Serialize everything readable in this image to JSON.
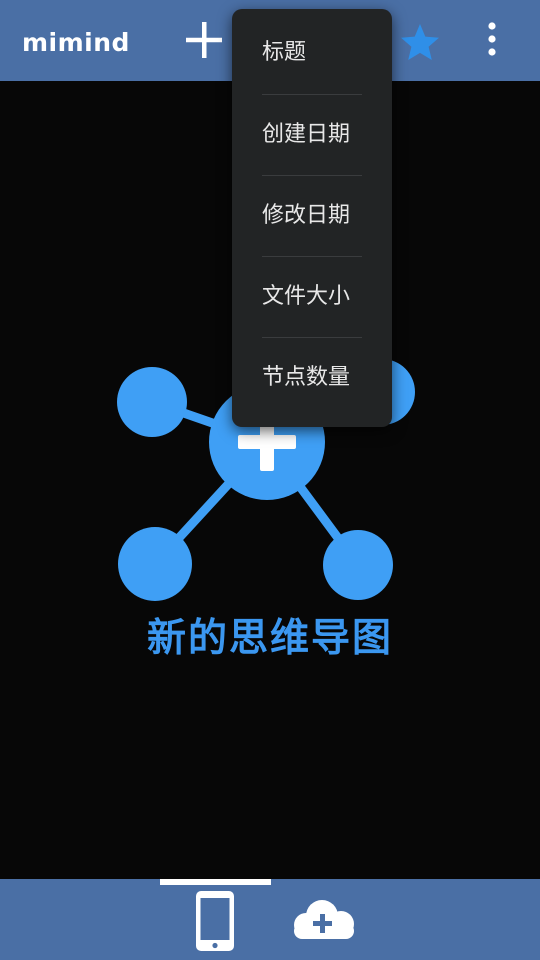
{
  "app": {
    "logo_text": "mimind"
  },
  "toolbar": {
    "add_icon": "plus-icon",
    "favorite_icon": "star-icon",
    "more_icon": "more-vertical-icon",
    "favorite_color": "#2f8fe8"
  },
  "sort_menu": {
    "items": [
      {
        "label": "标题"
      },
      {
        "label": "创建日期"
      },
      {
        "label": "修改日期"
      },
      {
        "label": "文件大小"
      },
      {
        "label": "节点数量"
      }
    ]
  },
  "main": {
    "new_map_label": "新的思维导图",
    "accent_color": "#3f9ff5"
  },
  "bottom_tabs": {
    "local_icon": "phone-icon",
    "cloud_icon": "cloud-add-icon",
    "selected": "local"
  },
  "colors": {
    "bar": "#4a6fa5",
    "background": "#070707",
    "menu": "#222425"
  }
}
